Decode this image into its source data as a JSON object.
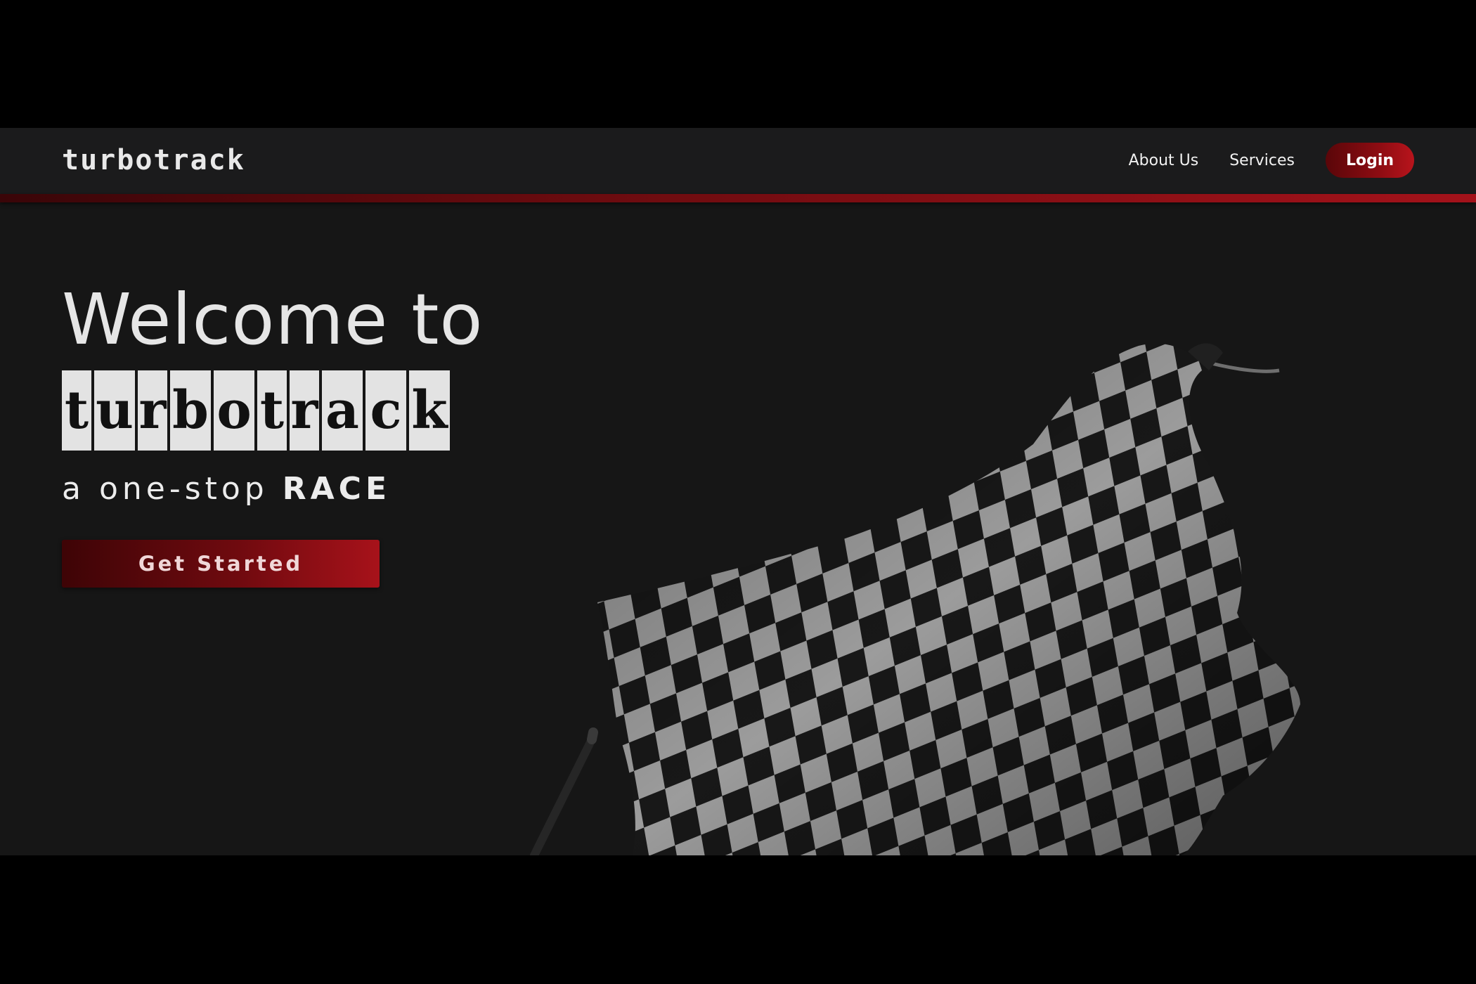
{
  "brand": {
    "name": "turbotrack"
  },
  "nav": {
    "links": [
      "About Us",
      "Services"
    ],
    "login_label": "Login"
  },
  "hero": {
    "title_line1": "Welcome to",
    "brand_letters": [
      "t",
      "u",
      "r",
      "b",
      "o",
      "t",
      "r",
      "a",
      "c",
      "k"
    ],
    "tagline_regular": "a one-stop ",
    "tagline_strong": "RACE",
    "cta_label": "Get Started",
    "image": "checkered-flag"
  },
  "colors": {
    "accent": "#8d0c12",
    "accent_dark": "#3e0406",
    "background": "#161616"
  }
}
